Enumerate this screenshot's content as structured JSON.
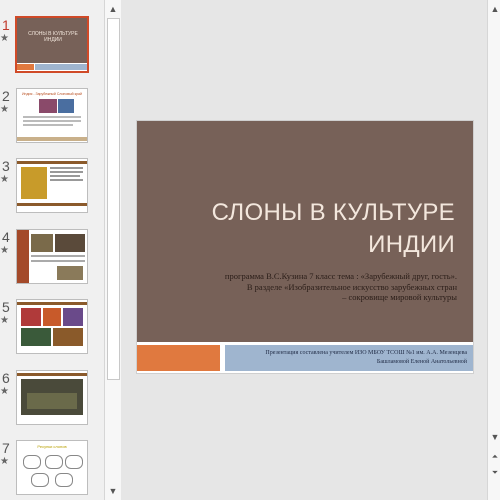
{
  "thumbnails": [
    {
      "number": "1",
      "star": "★",
      "title": "СЛОНЫ В КУЛЬТУРЕ ИНДИИ"
    },
    {
      "number": "2",
      "star": "★",
      "title": "Индия - Зарубежный Слоновый край"
    },
    {
      "number": "3",
      "star": "★"
    },
    {
      "number": "4",
      "star": "★"
    },
    {
      "number": "5",
      "star": "★"
    },
    {
      "number": "6",
      "star": "★"
    },
    {
      "number": "7",
      "star": "★",
      "title": "Ресунки слонов"
    }
  ],
  "slide": {
    "title_line1": "СЛОНЫ В КУЛЬТУРЕ",
    "title_line2": "ИНДИИ",
    "subtitle_line1": "программа В.С.Кузина  7 класс  тема :  «Зарубежный друг, гость».",
    "subtitle_line2": "В разделе «Изобразительное искусство зарубежных стран",
    "subtitle_line3": "– сокровище мировой культуры",
    "credit_line1": "Презентация  составлена учителем ИЗО МБОУ ТСОШ №1 им. А.А. Мезенцева",
    "credit_line2": "Башламовой Еленой Анатольевной"
  },
  "colors": {
    "slide_brown": "#776158",
    "accent_orange": "#e0793f",
    "accent_blue": "#9fb5cf",
    "selection": "#d04a28"
  }
}
